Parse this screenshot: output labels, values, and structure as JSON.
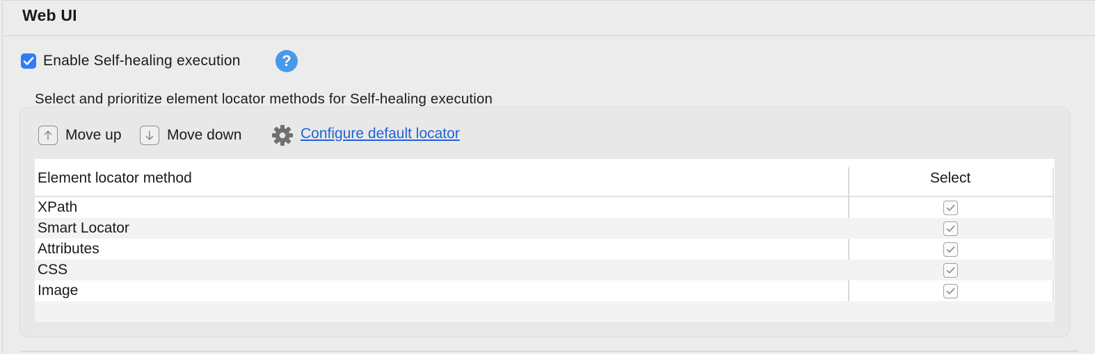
{
  "section": {
    "title": "Web UI"
  },
  "self_healing": {
    "enable_label": "Enable Self-healing execution",
    "enabled": true,
    "help_icon": "question-circle-icon",
    "group_caption": "Select and prioritize element locator methods for Self-healing execution"
  },
  "toolbar": {
    "move_up_label": "Move up",
    "move_up_icon": "arrow-up-icon",
    "move_down_label": "Move down",
    "move_down_icon": "arrow-down-icon",
    "settings_icon": "gear-icon",
    "configure_link": "Configure default locator"
  },
  "table": {
    "columns": [
      "Element locator method",
      "Select"
    ],
    "rows": [
      {
        "method": "XPath",
        "selected": true
      },
      {
        "method": "Smart Locator",
        "selected": true
      },
      {
        "method": "Attributes",
        "selected": true
      },
      {
        "method": "CSS",
        "selected": true
      },
      {
        "method": "Image",
        "selected": true
      }
    ]
  },
  "colors": {
    "accent": "#2f7cf6",
    "help": "#4a98e9",
    "link": "#1d63d8"
  }
}
